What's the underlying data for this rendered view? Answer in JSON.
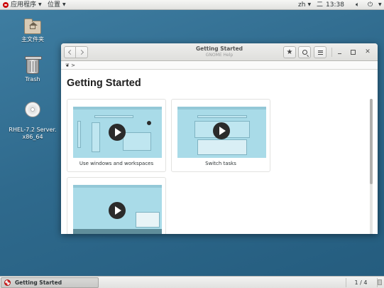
{
  "topbar": {
    "applications_label": "应用程序",
    "places_label": "位置",
    "input_method": "zh",
    "day": "二",
    "time": "13:38"
  },
  "desktop": {
    "icons": [
      {
        "label": "主文件夹",
        "icon": "home-folder-icon"
      },
      {
        "label": "Trash",
        "icon": "trash-icon"
      },
      {
        "label": "RHEL-7.2 Server.\nx86_64",
        "icon": "disc-icon"
      }
    ]
  },
  "window": {
    "title": "Getting Started",
    "subtitle": "GNOME Help",
    "page_title": "Getting Started",
    "breadcrumb_suffix": ">",
    "cards": [
      {
        "label": "Use windows and workspaces"
      },
      {
        "label": "Switch tasks"
      },
      {
        "label": ""
      }
    ]
  },
  "taskbar": {
    "task_label": "Getting Started",
    "workspace_indicator": "1 / 4"
  },
  "colors": {
    "desktop_bg": "#2f6a8d",
    "thumbnail_bg": "#a9dbe8",
    "play_button": "#2b2b2b"
  }
}
